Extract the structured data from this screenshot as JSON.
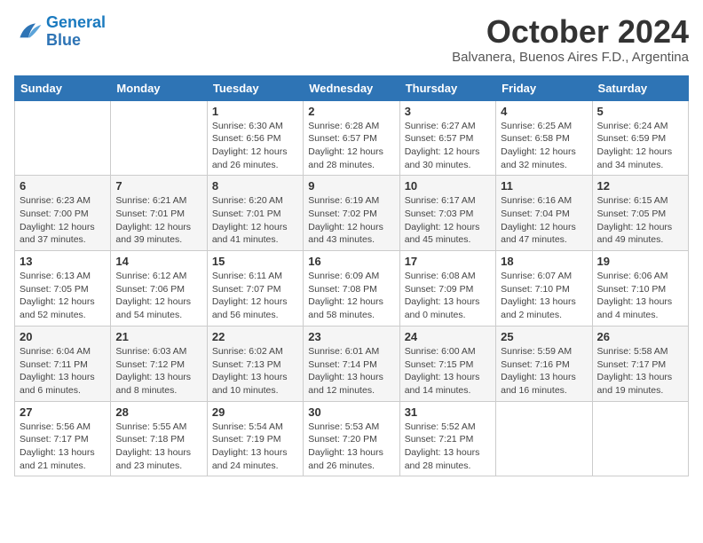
{
  "header": {
    "logo_line1": "General",
    "logo_line2": "Blue",
    "month": "October 2024",
    "location": "Balvanera, Buenos Aires F.D., Argentina"
  },
  "days_of_week": [
    "Sunday",
    "Monday",
    "Tuesday",
    "Wednesday",
    "Thursday",
    "Friday",
    "Saturday"
  ],
  "weeks": [
    [
      {
        "day": "",
        "info": ""
      },
      {
        "day": "",
        "info": ""
      },
      {
        "day": "1",
        "info": "Sunrise: 6:30 AM\nSunset: 6:56 PM\nDaylight: 12 hours and 26 minutes."
      },
      {
        "day": "2",
        "info": "Sunrise: 6:28 AM\nSunset: 6:57 PM\nDaylight: 12 hours and 28 minutes."
      },
      {
        "day": "3",
        "info": "Sunrise: 6:27 AM\nSunset: 6:57 PM\nDaylight: 12 hours and 30 minutes."
      },
      {
        "day": "4",
        "info": "Sunrise: 6:25 AM\nSunset: 6:58 PM\nDaylight: 12 hours and 32 minutes."
      },
      {
        "day": "5",
        "info": "Sunrise: 6:24 AM\nSunset: 6:59 PM\nDaylight: 12 hours and 34 minutes."
      }
    ],
    [
      {
        "day": "6",
        "info": "Sunrise: 6:23 AM\nSunset: 7:00 PM\nDaylight: 12 hours and 37 minutes."
      },
      {
        "day": "7",
        "info": "Sunrise: 6:21 AM\nSunset: 7:01 PM\nDaylight: 12 hours and 39 minutes."
      },
      {
        "day": "8",
        "info": "Sunrise: 6:20 AM\nSunset: 7:01 PM\nDaylight: 12 hours and 41 minutes."
      },
      {
        "day": "9",
        "info": "Sunrise: 6:19 AM\nSunset: 7:02 PM\nDaylight: 12 hours and 43 minutes."
      },
      {
        "day": "10",
        "info": "Sunrise: 6:17 AM\nSunset: 7:03 PM\nDaylight: 12 hours and 45 minutes."
      },
      {
        "day": "11",
        "info": "Sunrise: 6:16 AM\nSunset: 7:04 PM\nDaylight: 12 hours and 47 minutes."
      },
      {
        "day": "12",
        "info": "Sunrise: 6:15 AM\nSunset: 7:05 PM\nDaylight: 12 hours and 49 minutes."
      }
    ],
    [
      {
        "day": "13",
        "info": "Sunrise: 6:13 AM\nSunset: 7:05 PM\nDaylight: 12 hours and 52 minutes."
      },
      {
        "day": "14",
        "info": "Sunrise: 6:12 AM\nSunset: 7:06 PM\nDaylight: 12 hours and 54 minutes."
      },
      {
        "day": "15",
        "info": "Sunrise: 6:11 AM\nSunset: 7:07 PM\nDaylight: 12 hours and 56 minutes."
      },
      {
        "day": "16",
        "info": "Sunrise: 6:09 AM\nSunset: 7:08 PM\nDaylight: 12 hours and 58 minutes."
      },
      {
        "day": "17",
        "info": "Sunrise: 6:08 AM\nSunset: 7:09 PM\nDaylight: 13 hours and 0 minutes."
      },
      {
        "day": "18",
        "info": "Sunrise: 6:07 AM\nSunset: 7:10 PM\nDaylight: 13 hours and 2 minutes."
      },
      {
        "day": "19",
        "info": "Sunrise: 6:06 AM\nSunset: 7:10 PM\nDaylight: 13 hours and 4 minutes."
      }
    ],
    [
      {
        "day": "20",
        "info": "Sunrise: 6:04 AM\nSunset: 7:11 PM\nDaylight: 13 hours and 6 minutes."
      },
      {
        "day": "21",
        "info": "Sunrise: 6:03 AM\nSunset: 7:12 PM\nDaylight: 13 hours and 8 minutes."
      },
      {
        "day": "22",
        "info": "Sunrise: 6:02 AM\nSunset: 7:13 PM\nDaylight: 13 hours and 10 minutes."
      },
      {
        "day": "23",
        "info": "Sunrise: 6:01 AM\nSunset: 7:14 PM\nDaylight: 13 hours and 12 minutes."
      },
      {
        "day": "24",
        "info": "Sunrise: 6:00 AM\nSunset: 7:15 PM\nDaylight: 13 hours and 14 minutes."
      },
      {
        "day": "25",
        "info": "Sunrise: 5:59 AM\nSunset: 7:16 PM\nDaylight: 13 hours and 16 minutes."
      },
      {
        "day": "26",
        "info": "Sunrise: 5:58 AM\nSunset: 7:17 PM\nDaylight: 13 hours and 19 minutes."
      }
    ],
    [
      {
        "day": "27",
        "info": "Sunrise: 5:56 AM\nSunset: 7:17 PM\nDaylight: 13 hours and 21 minutes."
      },
      {
        "day": "28",
        "info": "Sunrise: 5:55 AM\nSunset: 7:18 PM\nDaylight: 13 hours and 23 minutes."
      },
      {
        "day": "29",
        "info": "Sunrise: 5:54 AM\nSunset: 7:19 PM\nDaylight: 13 hours and 24 minutes."
      },
      {
        "day": "30",
        "info": "Sunrise: 5:53 AM\nSunset: 7:20 PM\nDaylight: 13 hours and 26 minutes."
      },
      {
        "day": "31",
        "info": "Sunrise: 5:52 AM\nSunset: 7:21 PM\nDaylight: 13 hours and 28 minutes."
      },
      {
        "day": "",
        "info": ""
      },
      {
        "day": "",
        "info": ""
      }
    ]
  ]
}
